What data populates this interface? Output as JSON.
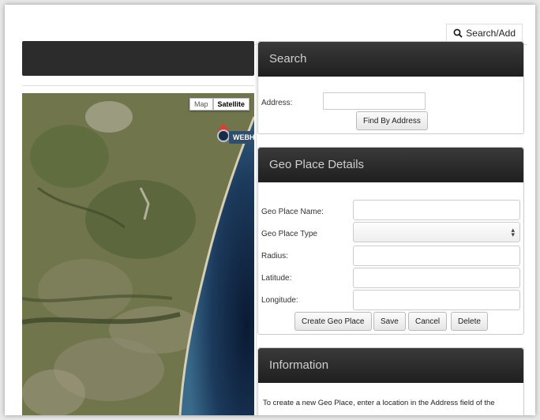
{
  "topbar": {
    "search_add_label": "Search/Add"
  },
  "map": {
    "type_options": [
      "Map",
      "Satellite"
    ],
    "selected_type": "Satellite",
    "marker_label": "WEBH"
  },
  "search_panel": {
    "title": "Search",
    "address_label": "Address:",
    "address_value": "",
    "find_button": "Find By Address"
  },
  "details_panel": {
    "title": "Geo Place Details",
    "name_label": "Geo Place Name:",
    "type_label": "Geo Place Type",
    "radius_label": "Radius:",
    "latitude_label": "Latitude:",
    "longitude_label": "Longitude:",
    "name_value": "",
    "type_value": "",
    "radius_value": "",
    "latitude_value": "",
    "longitude_value": "",
    "create_button": "Create Geo Place",
    "save_button": "Save",
    "cancel_button": "Cancel",
    "delete_button": "Delete"
  },
  "info_panel": {
    "title": "Information",
    "text": "To create a new Geo Place, enter a location in the Address field of the"
  },
  "colors": {
    "header_dark": "#2c2c2c",
    "marker_red": "#e53a2a",
    "label_blue": "#2f4d6e"
  }
}
